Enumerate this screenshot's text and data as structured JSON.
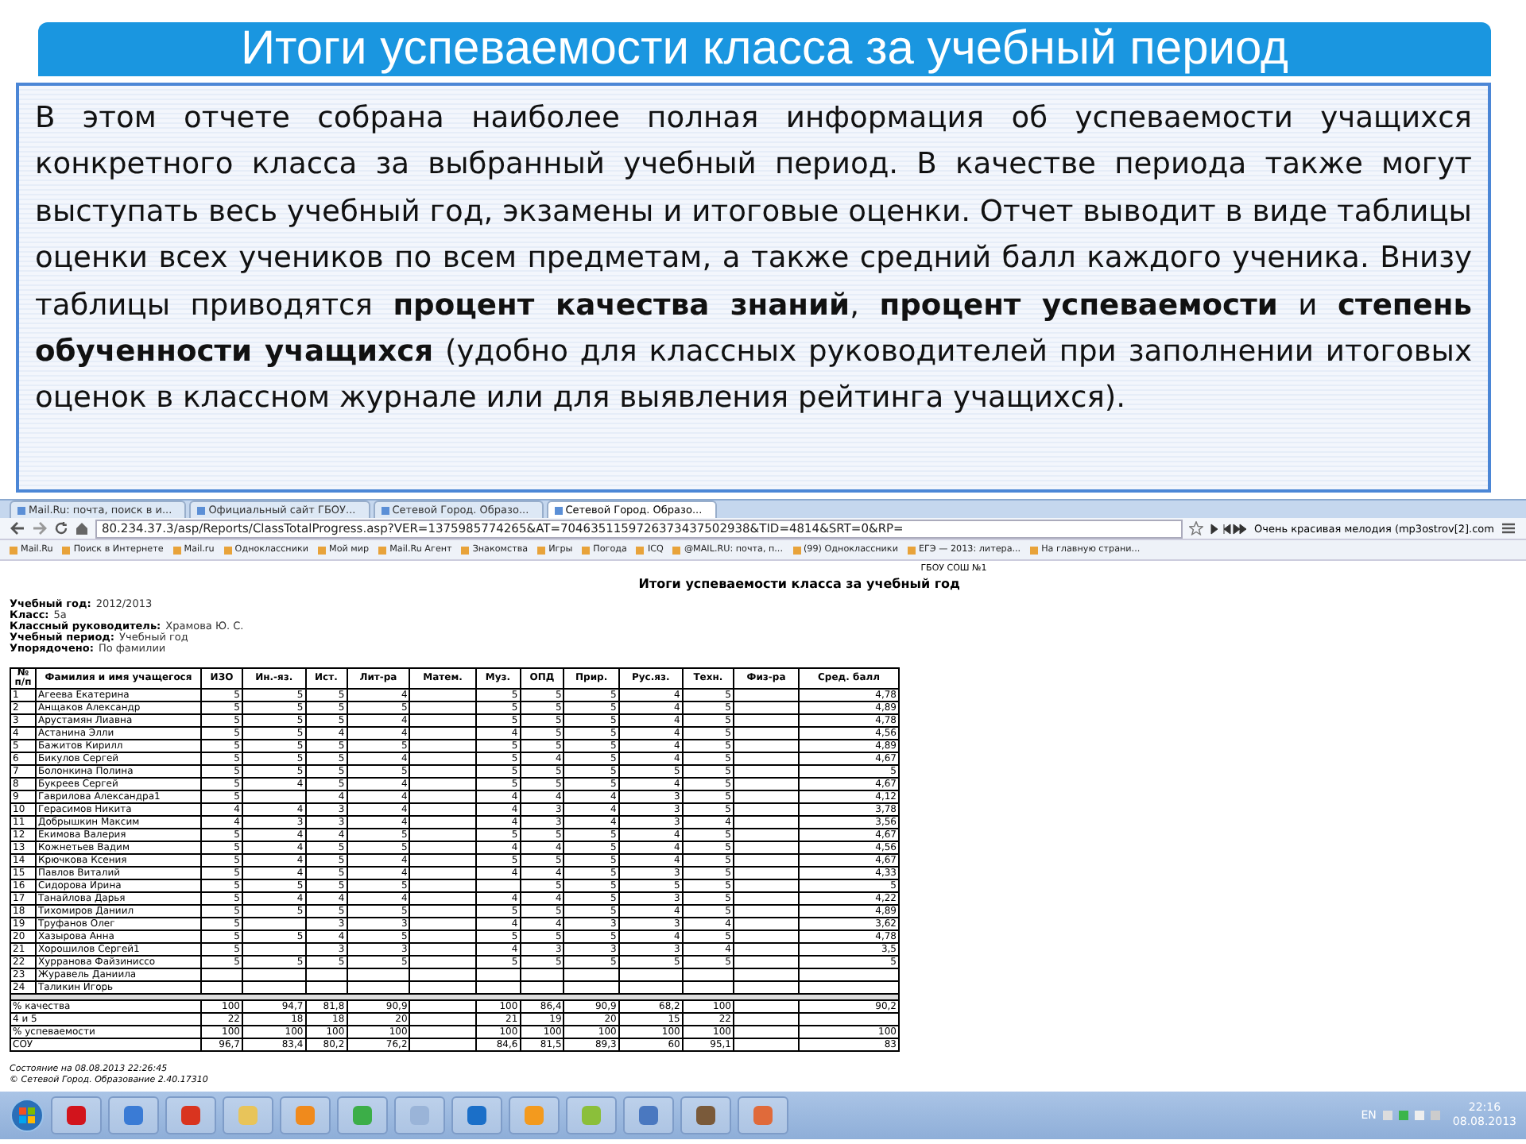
{
  "slide": {
    "title": "Итоги успеваемости класса за учебный период",
    "description": "В этом отчете собрана наиболее полная информация об успеваемости учащихся конкретного класса за выбранный учебный период. В качестве периода также могут выступать весь учебный год, экзамены и итоговые оценки. Отчет выводит в виде таблицы оценки всех учеников по всем предметам, а также средний балл каждого ученика. Внизу таблицы приводятся **процент качества знаний**, **процент успеваемости** и **степень обученности учащихся** (удобно для классных руководителей при заполнении итоговых оценок в классном журнале или для выявления рейтинга учащихся)."
  },
  "browser": {
    "tabs": [
      {
        "label": "Mail.Ru: почта, поиск в и...",
        "selected": false
      },
      {
        "label": "Официальный сайт ГБОУ...",
        "selected": false
      },
      {
        "label": "Сетевой Город. Образо...",
        "selected": false
      },
      {
        "label": "Сетевой Город. Образо...",
        "selected": true
      }
    ],
    "address": "80.234.37.3/asp/Reports/ClassTotalProgress.asp?VER=1375985774265&AT=7046351159726373437502938&TID=4814&SRT=0&RP=",
    "player_title": "Очень красивая мелодия (mp3ostrov[2].com",
    "bookmarks": [
      "Mail.Ru",
      "Поиск в Интернете",
      "Mail.ru",
      "Одноклассники",
      "Мой мир",
      "Mail.Ru Агент",
      "Знакомства",
      "Игры",
      "Погода",
      "ICQ",
      "@MAIL.RU: почта, п...",
      "(99) Одноклассники",
      "ЕГЭ — 2013: литера...",
      "На главную страни..."
    ],
    "page": {
      "school": "ГБОУ СОШ №1",
      "title": "Итоги успеваемости класса за учебный год",
      "info": [
        {
          "label": "Учебный год:",
          "value": "2012/2013"
        },
        {
          "label": "Класс:",
          "value": "5а"
        },
        {
          "label": "Классный руководитель:",
          "value": "Храмова Ю. С."
        },
        {
          "label": "Учебный период:",
          "value": "Учебный год"
        },
        {
          "label": "Упорядочено:",
          "value": "По фамилии"
        }
      ],
      "table": {
        "columns": [
          "№ п/п",
          "Фамилия и имя учащегося",
          "ИЗО",
          "Ин.-яз.",
          "Ист.",
          "Лит-ра",
          "Матем.",
          "Муз.",
          "ОПД",
          "Прир.",
          "Рус.яз.",
          "Техн.",
          "Физ-ра",
          "Сред. балл"
        ],
        "rows": [
          {
            "num": "1",
            "name": "Агеева Екатерина",
            "marks": {
              "izo": "5",
              "lang": "5",
              "hist": "5",
              "lit": "4",
              "music": "5",
              "opd": "5",
              "nature": "5",
              "rus": "4",
              "tech": "5",
              "avg": "4,78"
            }
          },
          {
            "num": "2",
            "name": "Анщаков Александр",
            "marks": {
              "izo": "5",
              "lang": "5",
              "hist": "5",
              "lit": "5",
              "music": "5",
              "opd": "5",
              "nature": "5",
              "rus": "4",
              "tech": "5",
              "avg": "4,89"
            }
          },
          {
            "num": "3",
            "name": "Арустамян Лиавна",
            "marks": {
              "izo": "5",
              "lang": "5",
              "hist": "5",
              "lit": "4",
              "music": "5",
              "opd": "5",
              "nature": "5",
              "rus": "4",
              "tech": "5",
              "avg": "4,78"
            }
          },
          {
            "num": "4",
            "name": "Астанина Элли",
            "marks": {
              "izo": "5",
              "lang": "5",
              "hist": "4",
              "lit": "4",
              "music": "4",
              "opd": "5",
              "nature": "5",
              "rus": "4",
              "tech": "5",
              "avg": "4,56"
            }
          },
          {
            "num": "5",
            "name": "Бажитов Кирилл",
            "marks": {
              "izo": "5",
              "lang": "5",
              "hist": "5",
              "lit": "5",
              "music": "5",
              "opd": "5",
              "nature": "5",
              "rus": "4",
              "tech": "5",
              "avg": "4,89"
            }
          },
          {
            "num": "6",
            "name": "Бикулов Сергей",
            "marks": {
              "izo": "5",
              "lang": "5",
              "hist": "5",
              "lit": "4",
              "music": "5",
              "opd": "4",
              "nature": "5",
              "rus": "4",
              "tech": "5",
              "avg": "4,67"
            }
          },
          {
            "num": "7",
            "name": "Болонкина Полина",
            "marks": {
              "izo": "5",
              "lang": "5",
              "hist": "5",
              "lit": "5",
              "music": "5",
              "opd": "5",
              "nature": "5",
              "rus": "5",
              "tech": "5",
              "avg": "5"
            }
          },
          {
            "num": "8",
            "name": "Букреев Сергей",
            "marks": {
              "izo": "5",
              "lang": "4",
              "hist": "5",
              "lit": "4",
              "music": "5",
              "opd": "5",
              "nature": "5",
              "rus": "4",
              "tech": "5",
              "avg": "4,67"
            }
          },
          {
            "num": "9",
            "name": "Гаврилова Александра1",
            "marks": {
              "izo": "5",
              "hist": "4",
              "lit": "4",
              "music": "4",
              "opd": "4",
              "nature": "4",
              "rus": "3",
              "tech": "5",
              "avg": "4,12"
            }
          },
          {
            "num": "10",
            "name": "Герасимов Никита",
            "marks": {
              "izo": "4",
              "lang": "4",
              "hist": "3",
              "lit": "4",
              "music": "4",
              "opd": "3",
              "nature": "4",
              "rus": "3",
              "tech": "5",
              "avg": "3,78"
            }
          },
          {
            "num": "11",
            "name": "Добрышкин Максим",
            "marks": {
              "izo": "4",
              "lang": "3",
              "hist": "3",
              "lit": "4",
              "music": "4",
              "opd": "3",
              "nature": "4",
              "rus": "3",
              "tech": "4",
              "avg": "3,56"
            }
          },
          {
            "num": "12",
            "name": "Екимова Валерия",
            "marks": {
              "izo": "5",
              "lang": "4",
              "hist": "4",
              "lit": "5",
              "music": "5",
              "opd": "5",
              "nature": "5",
              "rus": "4",
              "tech": "5",
              "avg": "4,67"
            }
          },
          {
            "num": "13",
            "name": "Кожнетьев Вадим",
            "marks": {
              "izo": "5",
              "lang": "4",
              "hist": "5",
              "lit": "5",
              "music": "4",
              "opd": "4",
              "nature": "5",
              "rus": "4",
              "tech": "5",
              "avg": "4,56"
            }
          },
          {
            "num": "14",
            "name": "Крючкова Ксения",
            "marks": {
              "izo": "5",
              "lang": "4",
              "hist": "5",
              "lit": "4",
              "music": "5",
              "opd": "5",
              "nature": "5",
              "rus": "4",
              "tech": "5",
              "avg": "4,67"
            }
          },
          {
            "num": "15",
            "name": "Павлов Виталий",
            "marks": {
              "izo": "5",
              "lang": "4",
              "hist": "5",
              "lit": "4",
              "music": "4",
              "opd": "4",
              "nature": "5",
              "rus": "3",
              "tech": "5",
              "avg": "4,33"
            }
          },
          {
            "num": "16",
            "name": "Сидорова Ирина",
            "marks": {
              "izo": "5",
              "lang": "5",
              "hist": "5",
              "lit": "5",
              "opd": "5",
              "nature": "5",
              "rus": "5",
              "tech": "5",
              "avg": "5"
            }
          },
          {
            "num": "17",
            "name": "Танайлова Дарья",
            "marks": {
              "izo": "5",
              "lang": "4",
              "hist": "4",
              "lit": "4",
              "music": "4",
              "opd": "4",
              "nature": "5",
              "rus": "3",
              "tech": "5",
              "avg": "4,22"
            }
          },
          {
            "num": "18",
            "name": "Тихомиров Даниил",
            "marks": {
              "izo": "5",
              "lang": "5",
              "hist": "5",
              "lit": "5",
              "music": "5",
              "opd": "5",
              "nature": "5",
              "rus": "4",
              "tech": "5",
              "avg": "4,89"
            }
          },
          {
            "num": "19",
            "name": "Труфанов Олег",
            "marks": {
              "izo": "5",
              "hist": "3",
              "lit": "3",
              "music": "4",
              "opd": "4",
              "nature": "3",
              "rus": "3",
              "tech": "4",
              "avg": "3,62"
            }
          },
          {
            "num": "20",
            "name": "Хазырова Анна",
            "marks": {
              "izo": "5",
              "lang": "5",
              "hist": "4",
              "lit": "5",
              "music": "5",
              "opd": "5",
              "nature": "5",
              "rus": "4",
              "tech": "5",
              "avg": "4,78"
            }
          },
          {
            "num": "21",
            "name": "Хорошилов Сергей1",
            "marks": {
              "izo": "5",
              "hist": "3",
              "lit": "3",
              "music": "4",
              "opd": "3",
              "nature": "3",
              "rus": "3",
              "tech": "4",
              "avg": "3,5"
            }
          },
          {
            "num": "22",
            "name": "Хурранова Файзиниссо",
            "marks": {
              "izo": "5",
              "lang": "5",
              "hist": "5",
              "lit": "5",
              "music": "5",
              "opd": "5",
              "nature": "5",
              "rus": "5",
              "tech": "5",
              "avg": "5"
            }
          },
          {
            "num": "23",
            "name": "Журавель Даниила"
          },
          {
            "num": "24",
            "name": "Таликин Игорь"
          }
        ],
        "summary": [
          {
            "label": "% качества",
            "marks": {
              "izo": "100",
              "lang": "94,7",
              "hist": "81,8",
              "lit": "90,9",
              "music": "100",
              "opd": "86,4",
              "nature": "90,9",
              "rus": "68,2",
              "tech": "100",
              "avg": "90,2"
            }
          },
          {
            "label": "4 и 5",
            "marks": {
              "izo": "22",
              "lang": "18",
              "hist": "18",
              "lit": "20",
              "music": "21",
              "opd": "19",
              "nature": "20",
              "rus": "15",
              "tech": "22"
            }
          },
          {
            "label": "% успеваемости",
            "marks": {
              "izo": "100",
              "lang": "100",
              "hist": "100",
              "lit": "100",
              "music": "100",
              "opd": "100",
              "nature": "100",
              "rus": "100",
              "tech": "100",
              "avg": "100"
            }
          },
          {
            "label": "СОУ",
            "marks": {
              "izo": "96,7",
              "lang": "83,4",
              "hist": "80,2",
              "lit": "76,2",
              "music": "84,6",
              "opd": "81,5",
              "nature": "89,3",
              "rus": "60",
              "tech": "95,1",
              "avg": "83"
            }
          }
        ]
      },
      "footer": [
        "Состояние на 08.08.2013 22:26:45",
        "© Сетевой Город. Образование 2.40.17310"
      ]
    }
  },
  "taskbar": {
    "language": "EN",
    "time": "22:16",
    "date": "08.08.2013"
  }
}
